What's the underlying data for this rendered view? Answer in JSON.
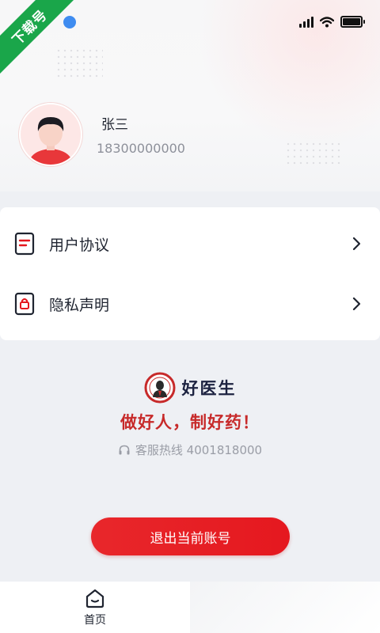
{
  "watermark": {
    "text": "下载号"
  },
  "user": {
    "name": "张三",
    "phone": "18300000000"
  },
  "menu": {
    "items": [
      {
        "label": "用户协议",
        "icon": "document-icon"
      },
      {
        "label": "隐私声明",
        "icon": "lock-document-icon"
      }
    ]
  },
  "brand": {
    "name": "好医生",
    "slogan": "做好人，制好药！",
    "hotline": "客服热线 4001818000"
  },
  "logout": {
    "label": "退出当前账号"
  },
  "tabbar": {
    "items": [
      {
        "label": "首页",
        "icon": "home-icon"
      }
    ]
  },
  "colors": {
    "accent": "#e5181f",
    "ribbon": "#1aa64a",
    "text": "#1f2430",
    "muted": "#8d909a"
  }
}
